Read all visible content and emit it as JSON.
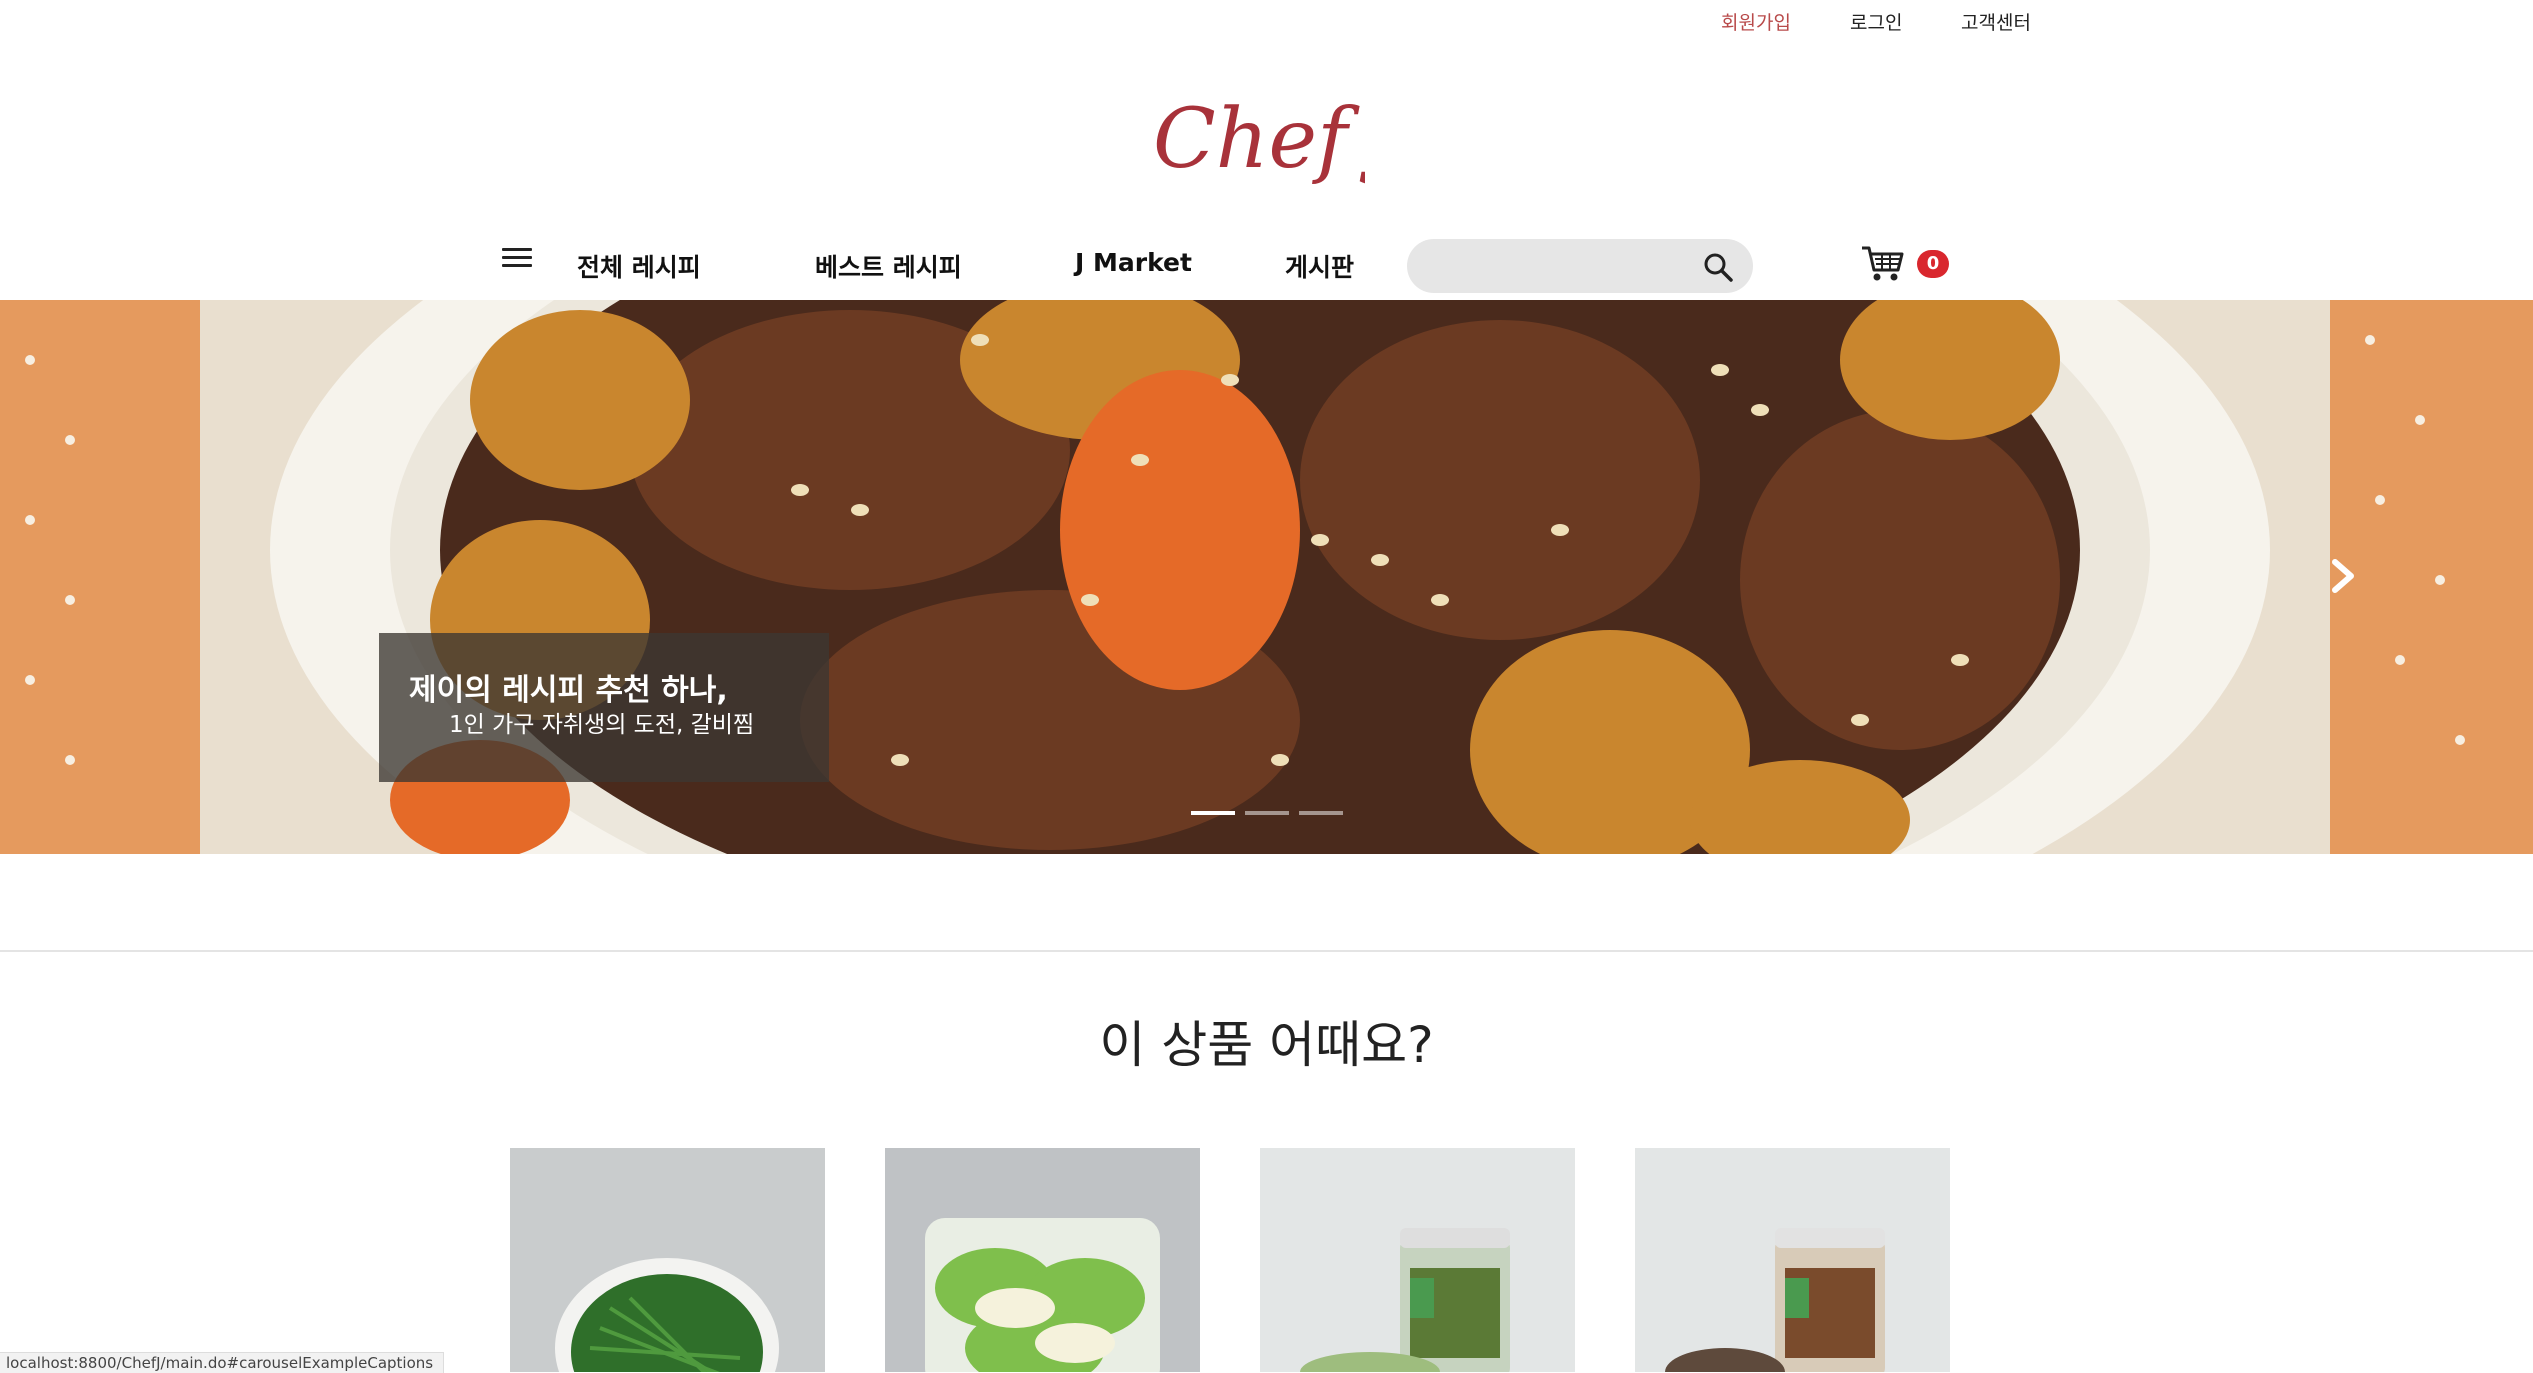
{
  "top_links": {
    "signup": "회원가입",
    "login": "로그인",
    "customer_center": "고객센터"
  },
  "logo": {
    "text": "Chef J",
    "color": "#a8323a"
  },
  "nav": {
    "items": [
      "전체 레시피",
      "베스트 레시피",
      "J Market",
      "게시판"
    ],
    "search_placeholder": "",
    "cart_count": "0"
  },
  "hero": {
    "caption_title": "제이의 레시피 추천 하나,",
    "caption_sub": "1인 가구 자취생의 도전, 갈비찜",
    "slides": 3,
    "active_slide": 1
  },
  "section": {
    "title": "이 상품 어때요?"
  },
  "products": [
    {
      "icon": "chives-image"
    },
    {
      "icon": "kimchi-image"
    },
    {
      "icon": "pickle-jar-image"
    },
    {
      "icon": "mushroom-jar-image"
    }
  ],
  "status_bar": {
    "url": "localhost:8800/ChefJ/main.do#carouselExampleCaptions"
  },
  "colors": {
    "accent": "#d9272e",
    "signup": "#b84a4a",
    "search_bg": "#e6e6e6"
  }
}
